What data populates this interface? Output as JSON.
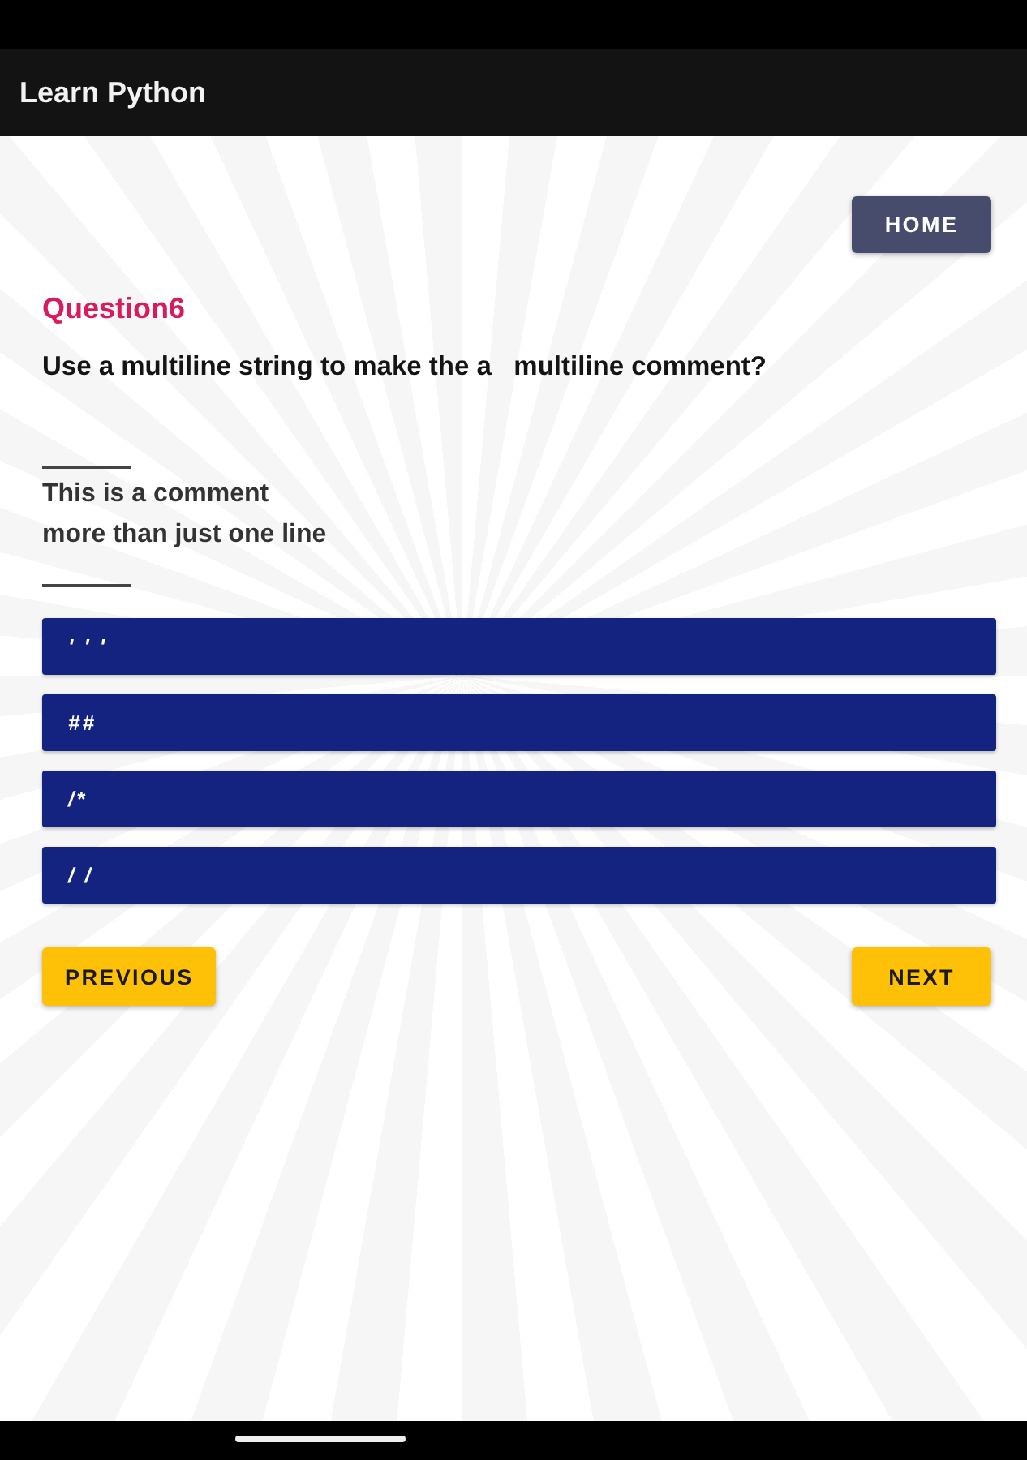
{
  "app_bar": {
    "title": "Learn Python"
  },
  "home_button": {
    "label": "HOME"
  },
  "question": {
    "number": "Question6",
    "text": "Use a multiline string to make the a   multiline comment?",
    "snippet": "This is a comment\nmore than just one line"
  },
  "options": [
    {
      "label": "' ' '",
      "selected": false
    },
    {
      "label": "##",
      "selected": false
    },
    {
      "label": "/*",
      "selected": false
    },
    {
      "label": "/ /",
      "selected": false
    }
  ],
  "navigation": {
    "previous": "PREVIOUS",
    "next": "NEXT"
  }
}
